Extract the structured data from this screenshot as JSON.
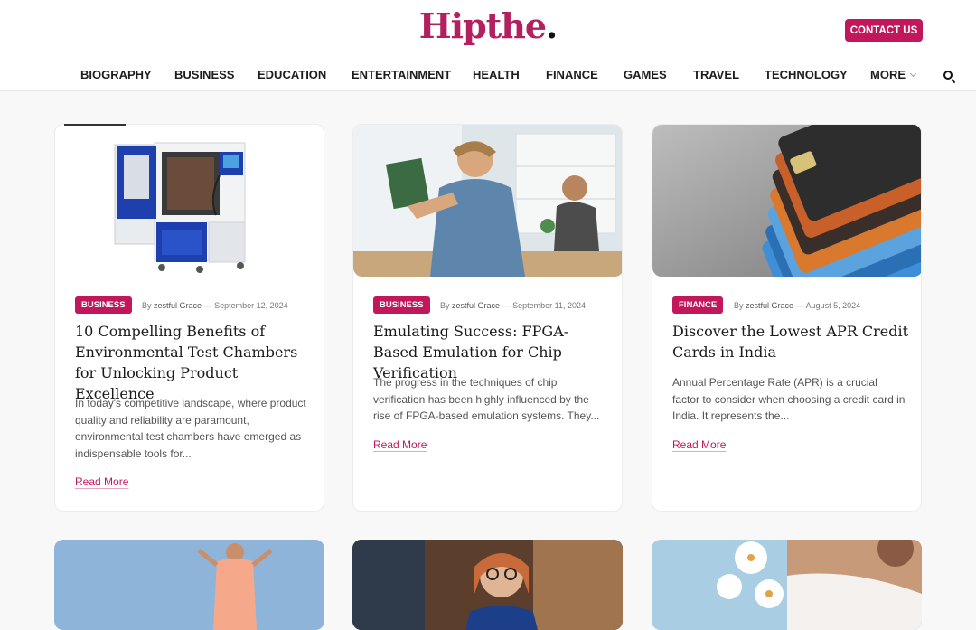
{
  "header": {
    "logo_text": "Hipthe",
    "logo_dot": ".",
    "contact_label": "CONTACT US"
  },
  "nav": {
    "items": [
      "BIOGRAPHY",
      "BUSINESS",
      "EDUCATION",
      "ENTERTAINMENT",
      "HEALTH",
      "FINANCE",
      "GAMES",
      "TRAVEL",
      "TECHNOLOGY"
    ],
    "more_label": "MORE",
    "search_icon": "search-icon"
  },
  "posts": [
    {
      "category": "BUSINESS",
      "author_prefix": "By",
      "author": "zestful Grace",
      "date": "September 12, 2024",
      "title": "10 Compelling Benefits of Environmental Test Chambers for Unlocking Product Excellence",
      "excerpt": "In today's competitive landscape, where product quality and reliability are paramount, environmental test chambers have emerged as indispensable tools for...",
      "read_more": "Read More",
      "image": "environmental-test-chamber"
    },
    {
      "category": "BUSINESS",
      "author_prefix": "By",
      "author": "zestful Grace",
      "date": "September 11, 2024",
      "title": "Emulating Success: FPGA-Based Emulation for Chip Verification",
      "excerpt": "The progress in the techniques of chip verification has been highly influenced by the rise of FPGA-based emulation systems. They...",
      "read_more": "Read More",
      "image": "engineers-with-circuit-board"
    },
    {
      "category": "FINANCE",
      "author_prefix": "By",
      "author": "zestful Grace",
      "date": "August 5, 2024",
      "title": "Discover the Lowest APR Credit Cards in India",
      "excerpt": "Annual Percentage Rate (APR) is a crucial factor to consider when choosing a credit card in India. It represents the...",
      "read_more": "Read More",
      "image": "stack-of-credit-cards"
    }
  ],
  "colors": {
    "accent": "#c2185b",
    "logo": "#b3205f"
  }
}
